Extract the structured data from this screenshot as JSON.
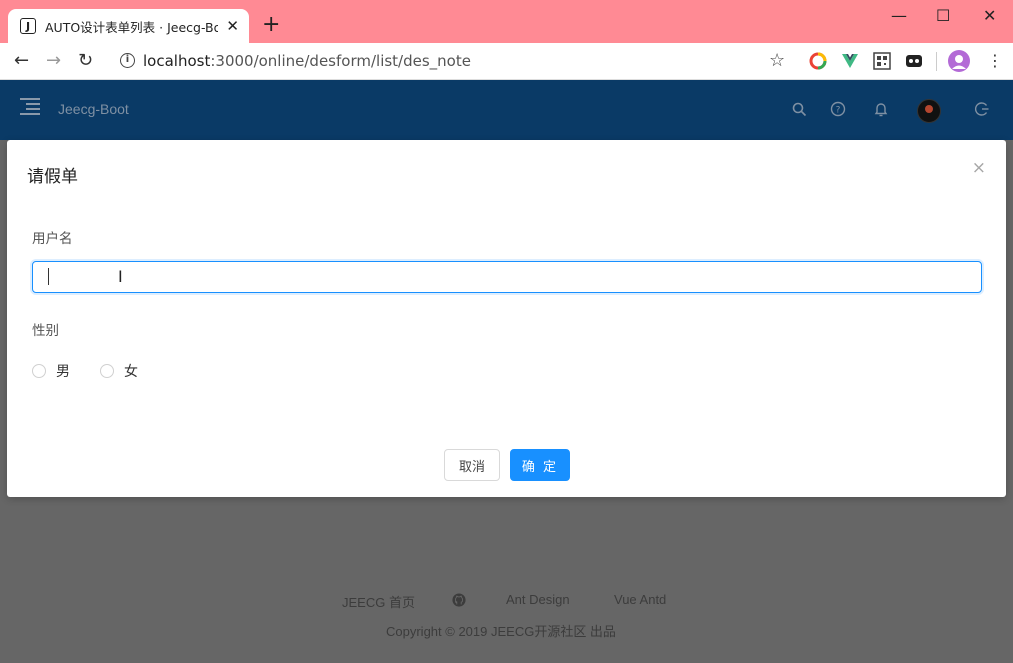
{
  "browser": {
    "tab_title": "AUTO设计表单列表 · Jeecg-Boo",
    "favicon_letter": "J",
    "close_glyph": "✕",
    "new_tab_glyph": "+",
    "url_host": "localhost",
    "url_path": ":3000/online/desform/list/des_note",
    "window_controls": [
      "—",
      "☐",
      "✕"
    ]
  },
  "app": {
    "brand": "Jeecg-Boot",
    "header_icons": [
      "search-icon",
      "help-icon",
      "bell-icon",
      "avatar",
      "logout-icon"
    ]
  },
  "modal": {
    "title": "请假单",
    "close_glyph": "×",
    "username_label": "用户名",
    "username_value": "",
    "gender_label": "性别",
    "gender_options": [
      "男",
      "女"
    ],
    "cancel_label": "取消",
    "ok_label": "确 定"
  },
  "footer": {
    "links": [
      "JEECG 首页",
      "Ant Design",
      "Vue Antd"
    ],
    "github_icon": "github-icon",
    "copyright": "Copyright © 2019 JEECG开源社区 出品"
  },
  "colors": {
    "tabbar": "#ff8a94",
    "header": "#0a3a66",
    "primary": "#1890ff",
    "overlay": "#666666"
  }
}
